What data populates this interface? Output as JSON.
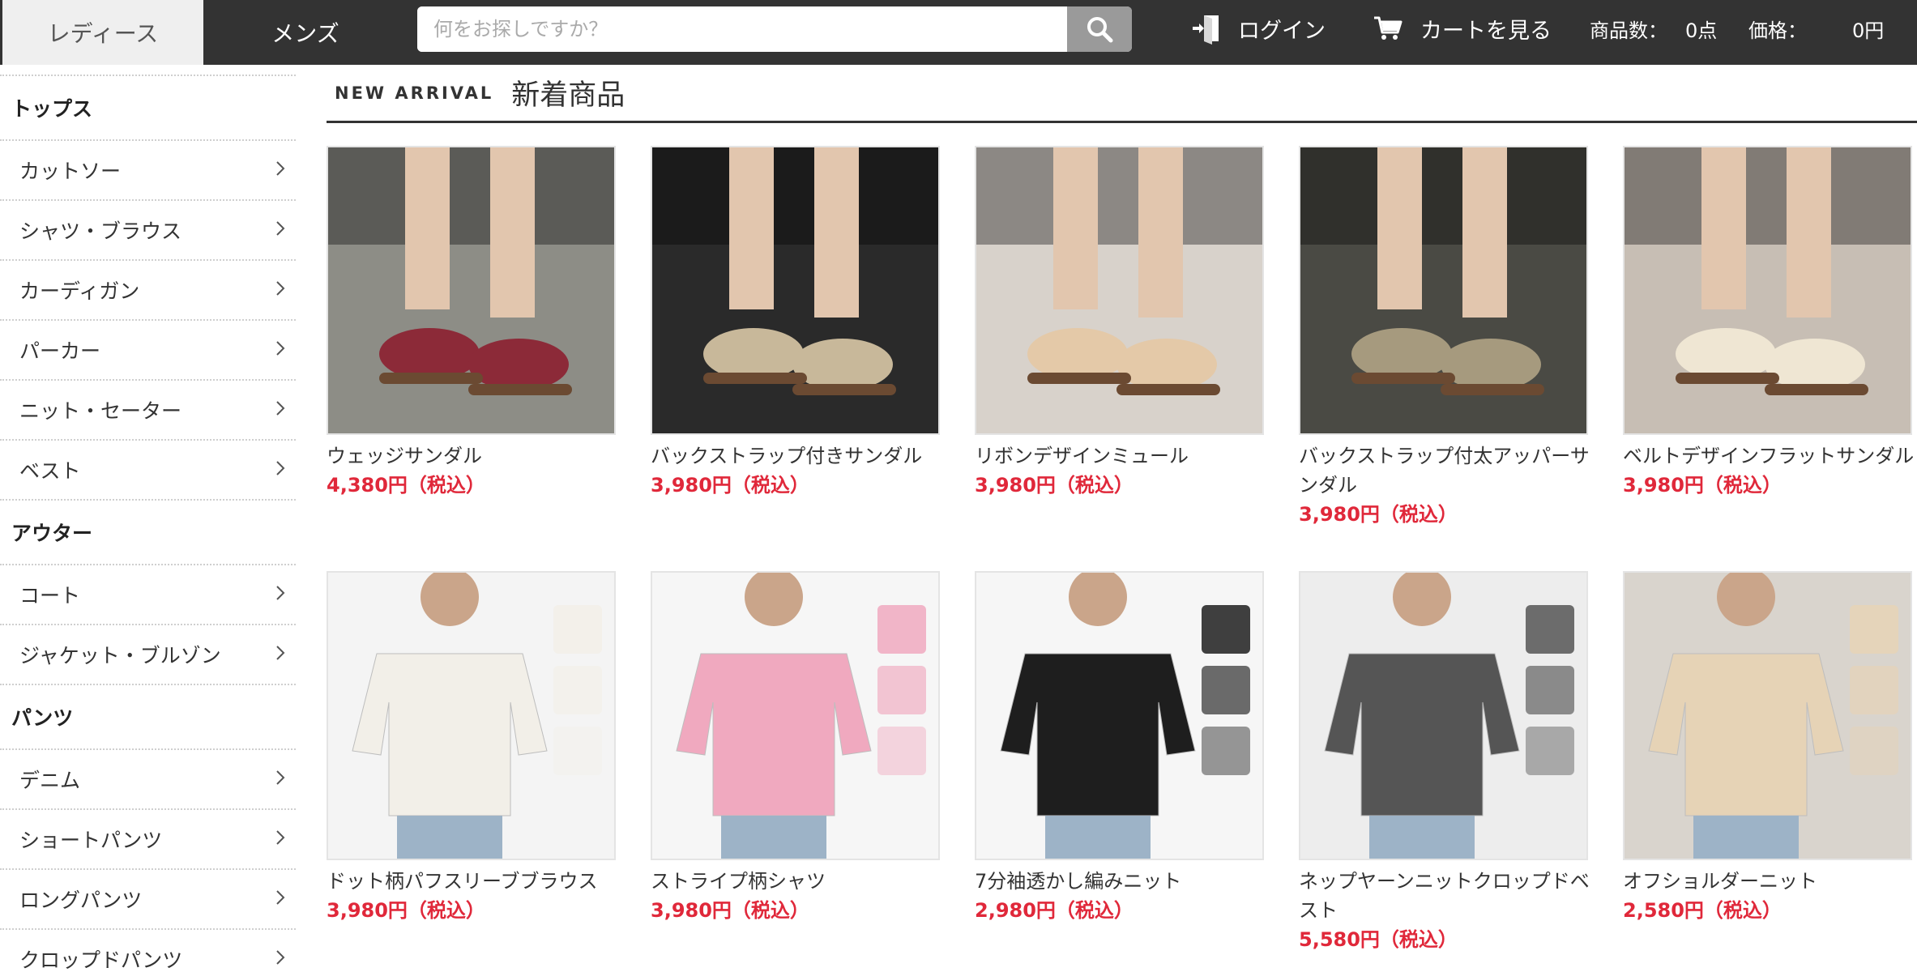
{
  "header": {
    "tabs": {
      "ladies": "レディース",
      "mens": "メンズ"
    },
    "search": {
      "placeholder": "何をお探しですか？"
    },
    "login_label": "ログイン",
    "cart_label": "カートを見る",
    "item_count_label": "商品数：",
    "item_count_value": "0点",
    "price_label": "価格：",
    "price_value": "0円"
  },
  "sidebar": {
    "groups": [
      {
        "title": "トップス",
        "items": [
          "カットソー",
          "シャツ・ブラウス",
          "カーディガン",
          "パーカー",
          "ニット・セーター",
          "ベスト"
        ]
      },
      {
        "title": "アウター",
        "items": [
          "コート",
          "ジャケット・ブルゾン"
        ]
      },
      {
        "title": "パンツ",
        "items": [
          "デニム",
          "ショートパンツ",
          "ロングパンツ",
          "クロップドパンツ"
        ]
      }
    ]
  },
  "main": {
    "heading_en": "NEW ARRIVAL",
    "heading_ja": "新着商品",
    "products": [
      {
        "name": "ウェッジサンダル",
        "price": "4,380円（税込）",
        "kind": "sandal",
        "bg": "#8d8d86",
        "color": "#8c2a38"
      },
      {
        "name": "バックストラップ付きサンダル",
        "price": "3,980円（税込）",
        "kind": "sandal",
        "bg": "#2a2a2a",
        "color": "#c8b89a"
      },
      {
        "name": "リボンデザインミュール",
        "price": "3,980円（税込）",
        "kind": "sandal",
        "bg": "#d8d2cb",
        "color": "#e4c9a8"
      },
      {
        "name": "バックストラップ付太アッパーサンダル",
        "price": "3,980円（税込）",
        "kind": "sandal",
        "bg": "#4a4a44",
        "color": "#a69a7e"
      },
      {
        "name": "ベルトデザインフラットサンダル",
        "price": "3,980円（税込）",
        "kind": "sandal",
        "bg": "#c7beb4",
        "color": "#efe6d3"
      },
      {
        "name": "ドット柄パフスリーブブラウス",
        "price": "3,980円（税込）",
        "kind": "top",
        "bg": "#f4f4f4",
        "color": "#f2efe8"
      },
      {
        "name": "ストライプ柄シャツ",
        "price": "3,980円（税込）",
        "kind": "top",
        "bg": "#f6f6f6",
        "color": "#f0a9bf"
      },
      {
        "name": "7分袖透かし編みニット",
        "price": "2,980円（税込）",
        "kind": "top",
        "bg": "#f6f6f6",
        "color": "#1e1e1e"
      },
      {
        "name": "ネップヤーンニットクロップドベスト",
        "price": "5,580円（税込）",
        "kind": "top",
        "bg": "#ededed",
        "color": "#555555"
      },
      {
        "name": "オフショルダーニット",
        "price": "2,580円（税込）",
        "kind": "top",
        "bg": "#d9d4cd",
        "color": "#e6d3b6"
      }
    ]
  },
  "colors": {
    "topbar": "#333333",
    "price": "#e0283a"
  },
  "icons": {
    "search": "search-icon",
    "login": "login-icon",
    "cart": "cart-icon",
    "chevron": "chevron-right-icon"
  }
}
